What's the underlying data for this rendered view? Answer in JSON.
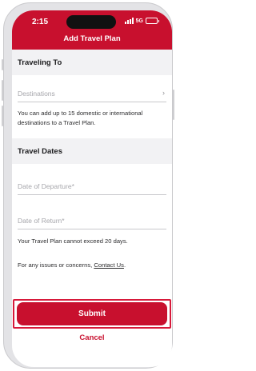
{
  "status_bar": {
    "time": "2:15",
    "network": "5G"
  },
  "header": {
    "title": "Add Travel Plan"
  },
  "traveling_to": {
    "heading": "Traveling To",
    "destinations_placeholder": "Destinations",
    "note": "You can add up to 15 domestic or international destinations to a Travel Plan."
  },
  "travel_dates": {
    "heading": "Travel Dates",
    "departure_placeholder": "Date of Departure*",
    "return_placeholder": "Date of Return*",
    "limit_note": "Your Travel Plan cannot exceed 20 days."
  },
  "contact": {
    "prefix": "For any issues or concerns, ",
    "link": "Contact Us",
    "suffix": "."
  },
  "actions": {
    "submit_label": "Submit",
    "cancel_label": "Cancel"
  },
  "colors": {
    "brand_red": "#c8102e",
    "section_bg": "#f2f2f4",
    "highlight_outline": "#d7193a"
  }
}
